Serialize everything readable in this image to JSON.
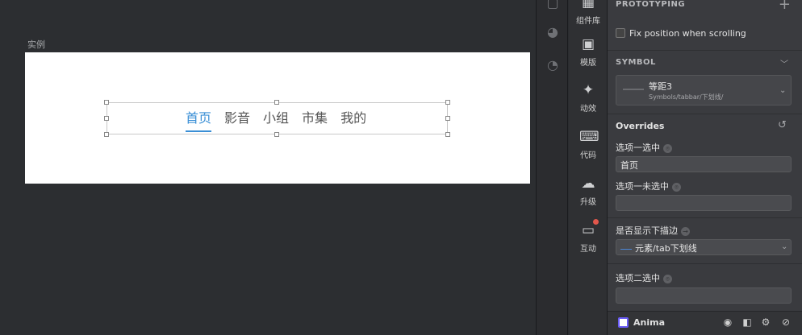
{
  "canvas": {
    "artboard_label": "实例",
    "tabs": [
      {
        "label": "首页",
        "active": true
      },
      {
        "label": "影音",
        "active": false
      },
      {
        "label": "小组",
        "active": false
      },
      {
        "label": "市集",
        "active": false
      },
      {
        "label": "我的",
        "active": false
      }
    ],
    "accent_color": "#3a8fd6"
  },
  "toolbar": {
    "items": [
      {
        "label": "组件库",
        "icon": "components-icon"
      },
      {
        "label": "模版",
        "icon": "template-icon"
      },
      {
        "label": "动效",
        "icon": "animation-icon"
      },
      {
        "label": "代码",
        "icon": "code-icon"
      },
      {
        "label": "升级",
        "icon": "upgrade-icon"
      },
      {
        "label": "互动",
        "icon": "comment-icon"
      }
    ]
  },
  "inspector": {
    "prototyping_title": "PROTOTYPING",
    "fix_position_label": "Fix position when scrolling",
    "symbol_title": "SYMBOL",
    "symbol_name": "等距3",
    "symbol_path": "Symbols/tabbar/下划线/",
    "overrides_title": "Overrides",
    "override1_label": "选项一选中",
    "override1_value": "首页",
    "override2_label": "选项一未选中",
    "override2_value": "",
    "override3_label": "是否显示下描边",
    "override3_value": "元素/tab下划线",
    "override4_label": "选项二选中",
    "override4_value": ""
  },
  "bottom_bar": {
    "plugin_name": "Anima"
  }
}
